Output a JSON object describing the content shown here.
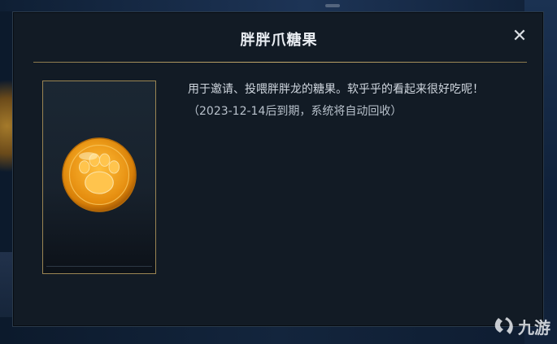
{
  "modal": {
    "title": "胖胖爪糖果",
    "close_symbol": "✕"
  },
  "item": {
    "icon": "paw-candy-coin-icon",
    "description_line1": "用于邀请、投喂胖胖龙的糖果。软乎乎的看起来很好吃呢！",
    "description_line2": "（2023-12-14后到期，系统将自动回收）"
  },
  "watermark": {
    "text": "九游"
  },
  "colors": {
    "modal_bg": "#121b25",
    "gold_accent": "#c6ab6c",
    "coin_orange": "#f0a21c"
  }
}
